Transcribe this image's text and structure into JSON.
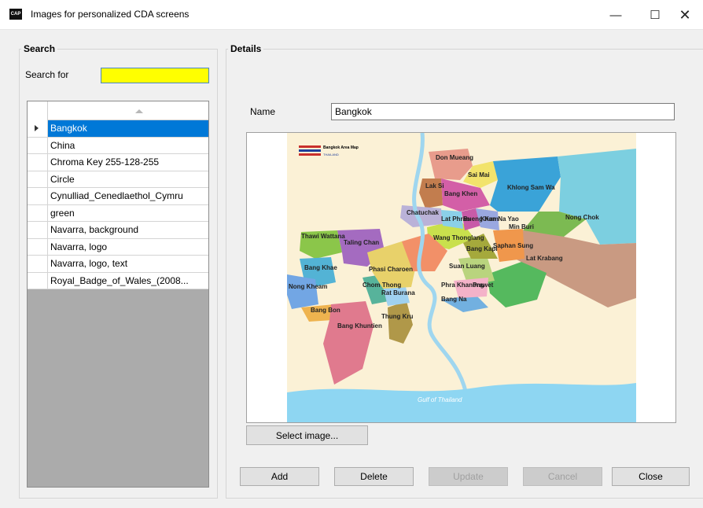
{
  "window": {
    "title": "Images for personalized CDA screens",
    "app_icon_text": "CAP",
    "minimize_glyph": "—",
    "maximize_glyph": "☐",
    "close_glyph": "✕"
  },
  "search": {
    "group_label": "Search",
    "search_for_label": "Search for",
    "search_value": "",
    "images": [
      {
        "name": "Bangkok",
        "selected": true
      },
      {
        "name": "China",
        "selected": false
      },
      {
        "name": "Chroma Key 255-128-255",
        "selected": false
      },
      {
        "name": "Circle",
        "selected": false
      },
      {
        "name": "Cynulliad_Cenedlaethol_Cymru",
        "selected": false
      },
      {
        "name": "green",
        "selected": false
      },
      {
        "name": "Navarra, background",
        "selected": false
      },
      {
        "name": "Navarra, logo",
        "selected": false
      },
      {
        "name": "Navarra, logo, text",
        "selected": false
      },
      {
        "name": "Royal_Badge_of_Wales_(2008...",
        "selected": false
      }
    ]
  },
  "details": {
    "group_label": "Details",
    "name_label": "Name",
    "name_value": "Bangkok",
    "map": {
      "legend_title": "Bangkok Area Map",
      "legend_sub": "THAILAND",
      "districts": [
        "Don Mueang",
        "Sai Mai",
        "Lak Si",
        "Bang Khen",
        "Khlong Sam Wa",
        "Nong Chok",
        "Min Buri",
        "Lat Krabang",
        "Thawi Wattana",
        "Taling Chan",
        "Bang Khae",
        "Nong Kheam",
        "Bang Bon",
        "Bang Khuntien",
        "Chom Thong",
        "Thung Kru",
        "Rat Burana",
        "Prawet",
        "Bang Na",
        "Suan Luang",
        "Phra Khanong",
        "Wang Thonglang",
        "Bang Kapi",
        "Saphan Sung",
        "Chatuchak",
        "Lat Phrao",
        "Bueng Kum",
        "Khan Na Yao",
        "Phasi Charoen"
      ],
      "sea_label": "Gulf of Thailand"
    },
    "select_image_label": "Select image..."
  },
  "actions": {
    "add": "Add",
    "delete": "Delete",
    "update": "Update",
    "cancel": "Cancel",
    "close": "Close"
  },
  "colors": {
    "search_highlight": "#ffff00",
    "selection": "#0078d7",
    "grid_background": "#ababab"
  }
}
